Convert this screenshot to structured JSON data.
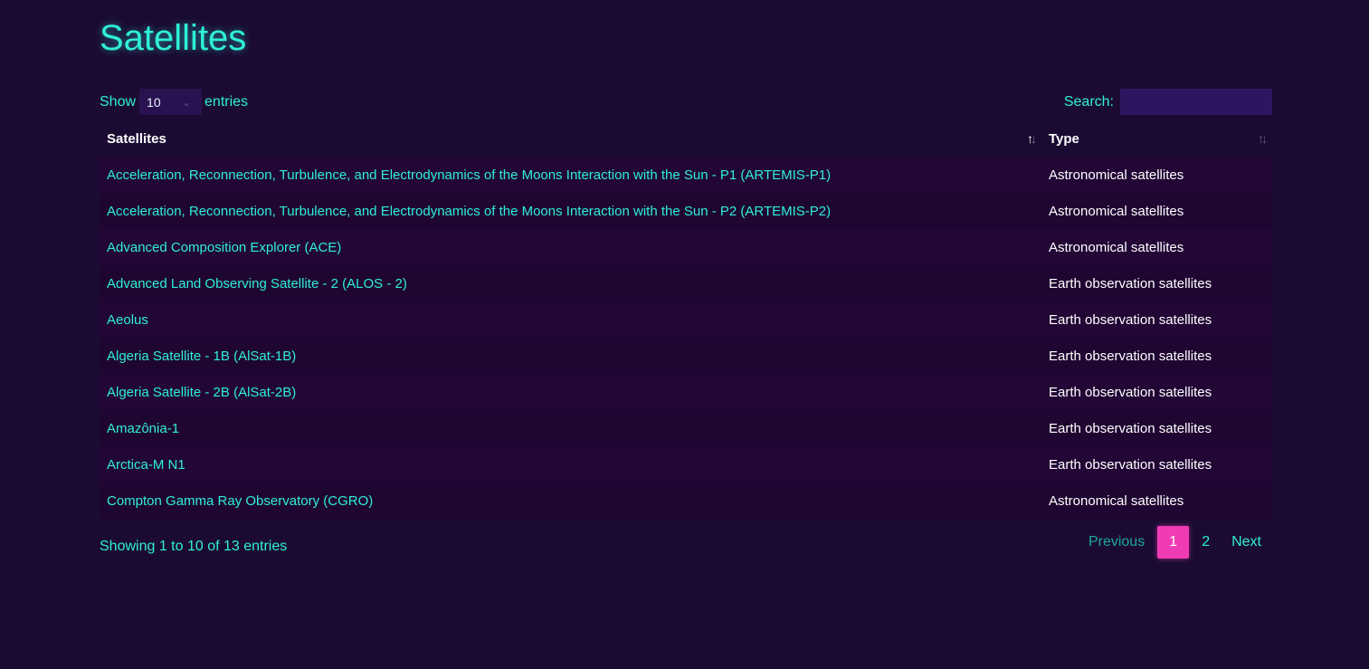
{
  "page": {
    "title": "Satellites"
  },
  "controls": {
    "show_label": "Show",
    "page_length": "10",
    "entries_label": "entries",
    "search_label": "Search:",
    "search_value": ""
  },
  "table": {
    "headers": [
      "Satellites",
      "Type"
    ],
    "rows": [
      {
        "name": "Acceleration, Reconnection, Turbulence, and Electrodynamics of the Moons Interaction with the Sun - P1 (ARTEMIS-P1)",
        "type": "Astronomical satellites"
      },
      {
        "name": "Acceleration, Reconnection, Turbulence, and Electrodynamics of the Moons Interaction with the Sun - P2 (ARTEMIS-P2)",
        "type": "Astronomical satellites"
      },
      {
        "name": "Advanced Composition Explorer (ACE)",
        "type": "Astronomical satellites"
      },
      {
        "name": "Advanced Land Observing Satellite - 2 (ALOS - 2)",
        "type": "Earth observation satellites"
      },
      {
        "name": "Aeolus",
        "type": "Earth observation satellites"
      },
      {
        "name": "Algeria Satellite - 1B (AlSat-1B)",
        "type": "Earth observation satellites"
      },
      {
        "name": "Algeria Satellite - 2B (AlSat-2B)",
        "type": "Earth observation satellites"
      },
      {
        "name": "Amazônia-1",
        "type": "Earth observation satellites"
      },
      {
        "name": "Arctica-M N1",
        "type": "Earth observation satellites"
      },
      {
        "name": "Compton Gamma Ray Observatory (CGRO)",
        "type": "Astronomical satellites"
      }
    ]
  },
  "footer": {
    "info": "Showing 1 to 10 of 13 entries",
    "pagination": {
      "previous": "Previous",
      "pages": [
        "1",
        "2"
      ],
      "current": "1",
      "next": "Next"
    }
  },
  "colors": {
    "background": "#1b0b33",
    "accent": "#2ef0d6",
    "active_page": "#f03cb4"
  }
}
